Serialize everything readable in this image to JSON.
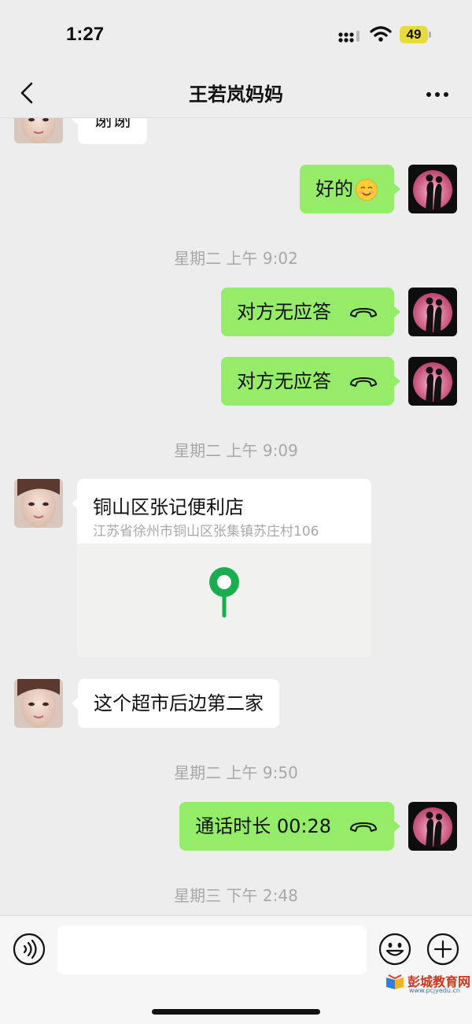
{
  "status_bar": {
    "time": "1:27",
    "battery": "49"
  },
  "nav": {
    "title": "王若岚妈妈"
  },
  "messages": {
    "thanks": "谢谢",
    "ok": "好的",
    "missed_call_1": "对方无应答",
    "missed_call_2": "对方无应答",
    "store_followup": "这个超市后边第二家",
    "call_duration": "通话时长 00:28"
  },
  "timestamps": {
    "t1": "星期二 上午 9:02",
    "t2": "星期二 上午 9:09",
    "t3": "星期二 上午 9:50",
    "t4": "星期三 下午 2:48"
  },
  "location": {
    "name": "铜山区张记便利店",
    "address": "江苏省徐州市铜山区张集镇苏庄村106"
  },
  "input_bar": {
    "placeholder": ""
  },
  "watermark": {
    "text": "彭城教育网",
    "url": "www.pcjyedu.cn"
  },
  "colors": {
    "outgoing_bubble": "#95ec69",
    "incoming_bubble": "#ffffff",
    "background": "#ededed",
    "map_pin": "#1aad4e"
  },
  "icons": [
    "back-icon",
    "more-icon",
    "phone-icon",
    "smile-emoji-icon",
    "map-pin-icon",
    "voice-icon",
    "emoji-icon",
    "plus-icon"
  ]
}
